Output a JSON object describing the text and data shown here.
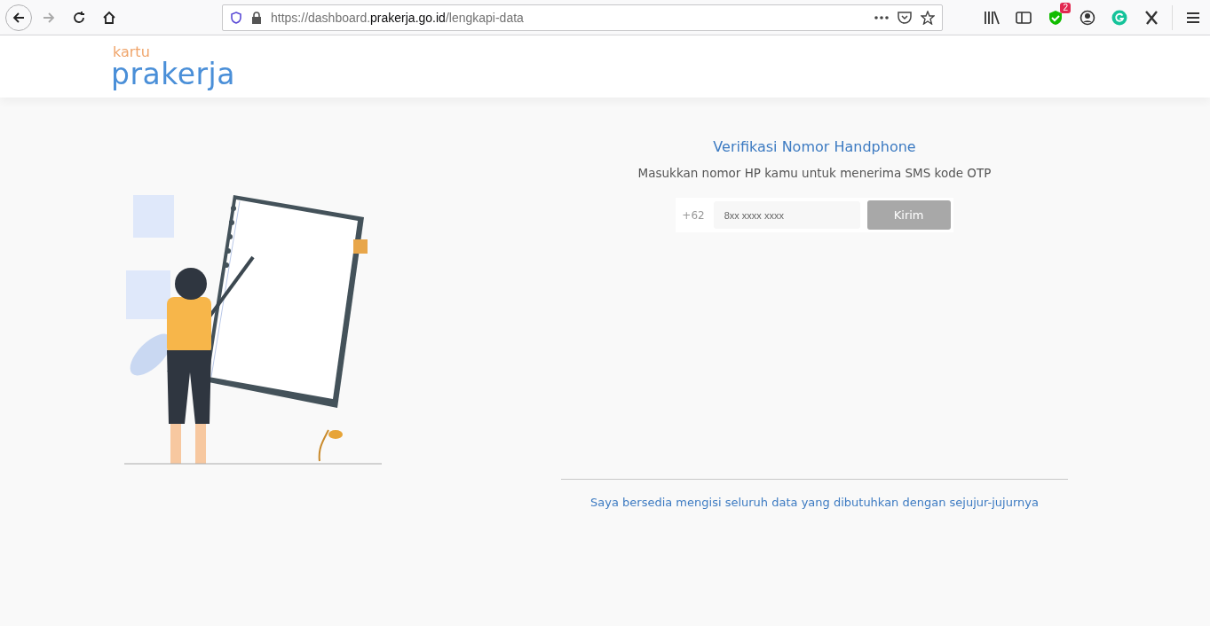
{
  "browser": {
    "url": {
      "scheme": "https://dashboard.",
      "domain": "prakerja.go.id",
      "path": "/lengkapi-data"
    },
    "badge": "2"
  },
  "header": {
    "logo_small": "kartu",
    "logo_big": "prakerja"
  },
  "form": {
    "title": "Verifikasi Nomor Handphone",
    "subtitle": "Masukkan nomor HP kamu untuk menerima SMS kode OTP",
    "prefix": "+62",
    "placeholder": "8xx xxxx xxxx",
    "button": {
      "label": "Kirim",
      "disabled": true
    }
  },
  "footer_note": "Saya bersedia mengisi seluruh data yang dibutuhkan dengan sejujur-jujurnya"
}
